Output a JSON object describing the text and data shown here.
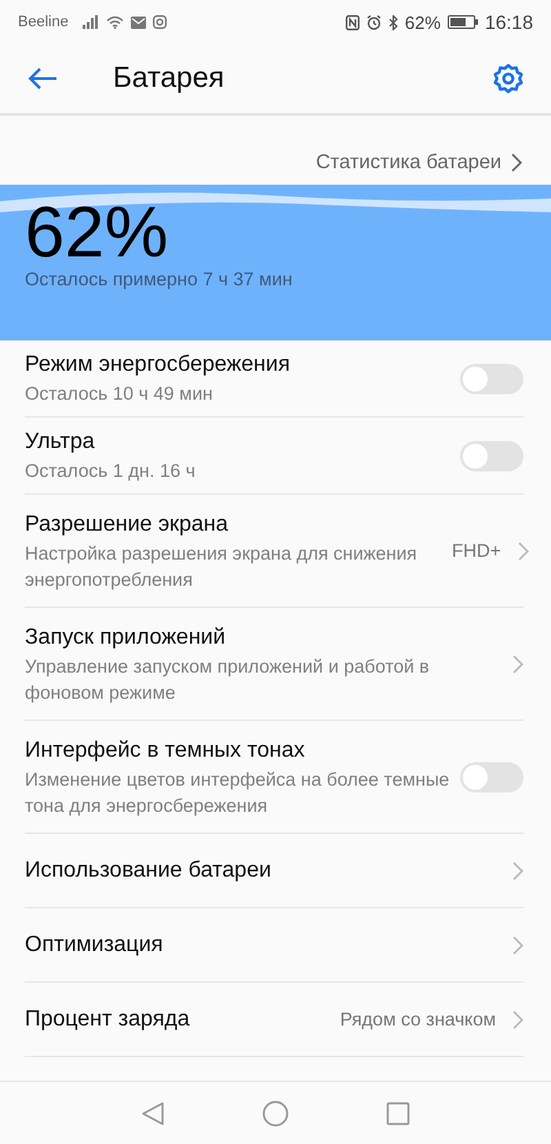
{
  "status_bar": {
    "carrier": "Beeline",
    "battery_percent": "62%",
    "time": "16:18"
  },
  "app_bar": {
    "title": "Батарея"
  },
  "stats_link": {
    "label": "Статистика батареи"
  },
  "battery": {
    "percent": "62%",
    "estimate": "Осталось примерно 7 ч 37 мин"
  },
  "items": [
    {
      "kind": "toggle",
      "title": "Режим энергосбережения",
      "subtitle": "Осталось 10 ч 49 мин",
      "on": false
    },
    {
      "kind": "toggle",
      "title": "Ультра",
      "subtitle": "Осталось 1 дн. 16 ч",
      "on": false
    },
    {
      "kind": "link",
      "title": "Разрешение экрана",
      "subtitle": "Настройка разрешения экрана для снижения энергопотребления",
      "value": "FHD+"
    },
    {
      "kind": "link",
      "title": "Запуск приложений",
      "subtitle": "Управление запуском приложений и работой в фоновом режиме"
    },
    {
      "kind": "toggle",
      "title": "Интерфейс в темных тонах",
      "subtitle": "Изменение цветов интерфейса на более темные тона для энергосбережения",
      "on": false
    },
    {
      "kind": "link",
      "title": "Использование батареи"
    },
    {
      "kind": "link",
      "title": "Оптимизация"
    },
    {
      "kind": "link",
      "title": "Процент заряда",
      "value": "Рядом со значком"
    }
  ]
}
